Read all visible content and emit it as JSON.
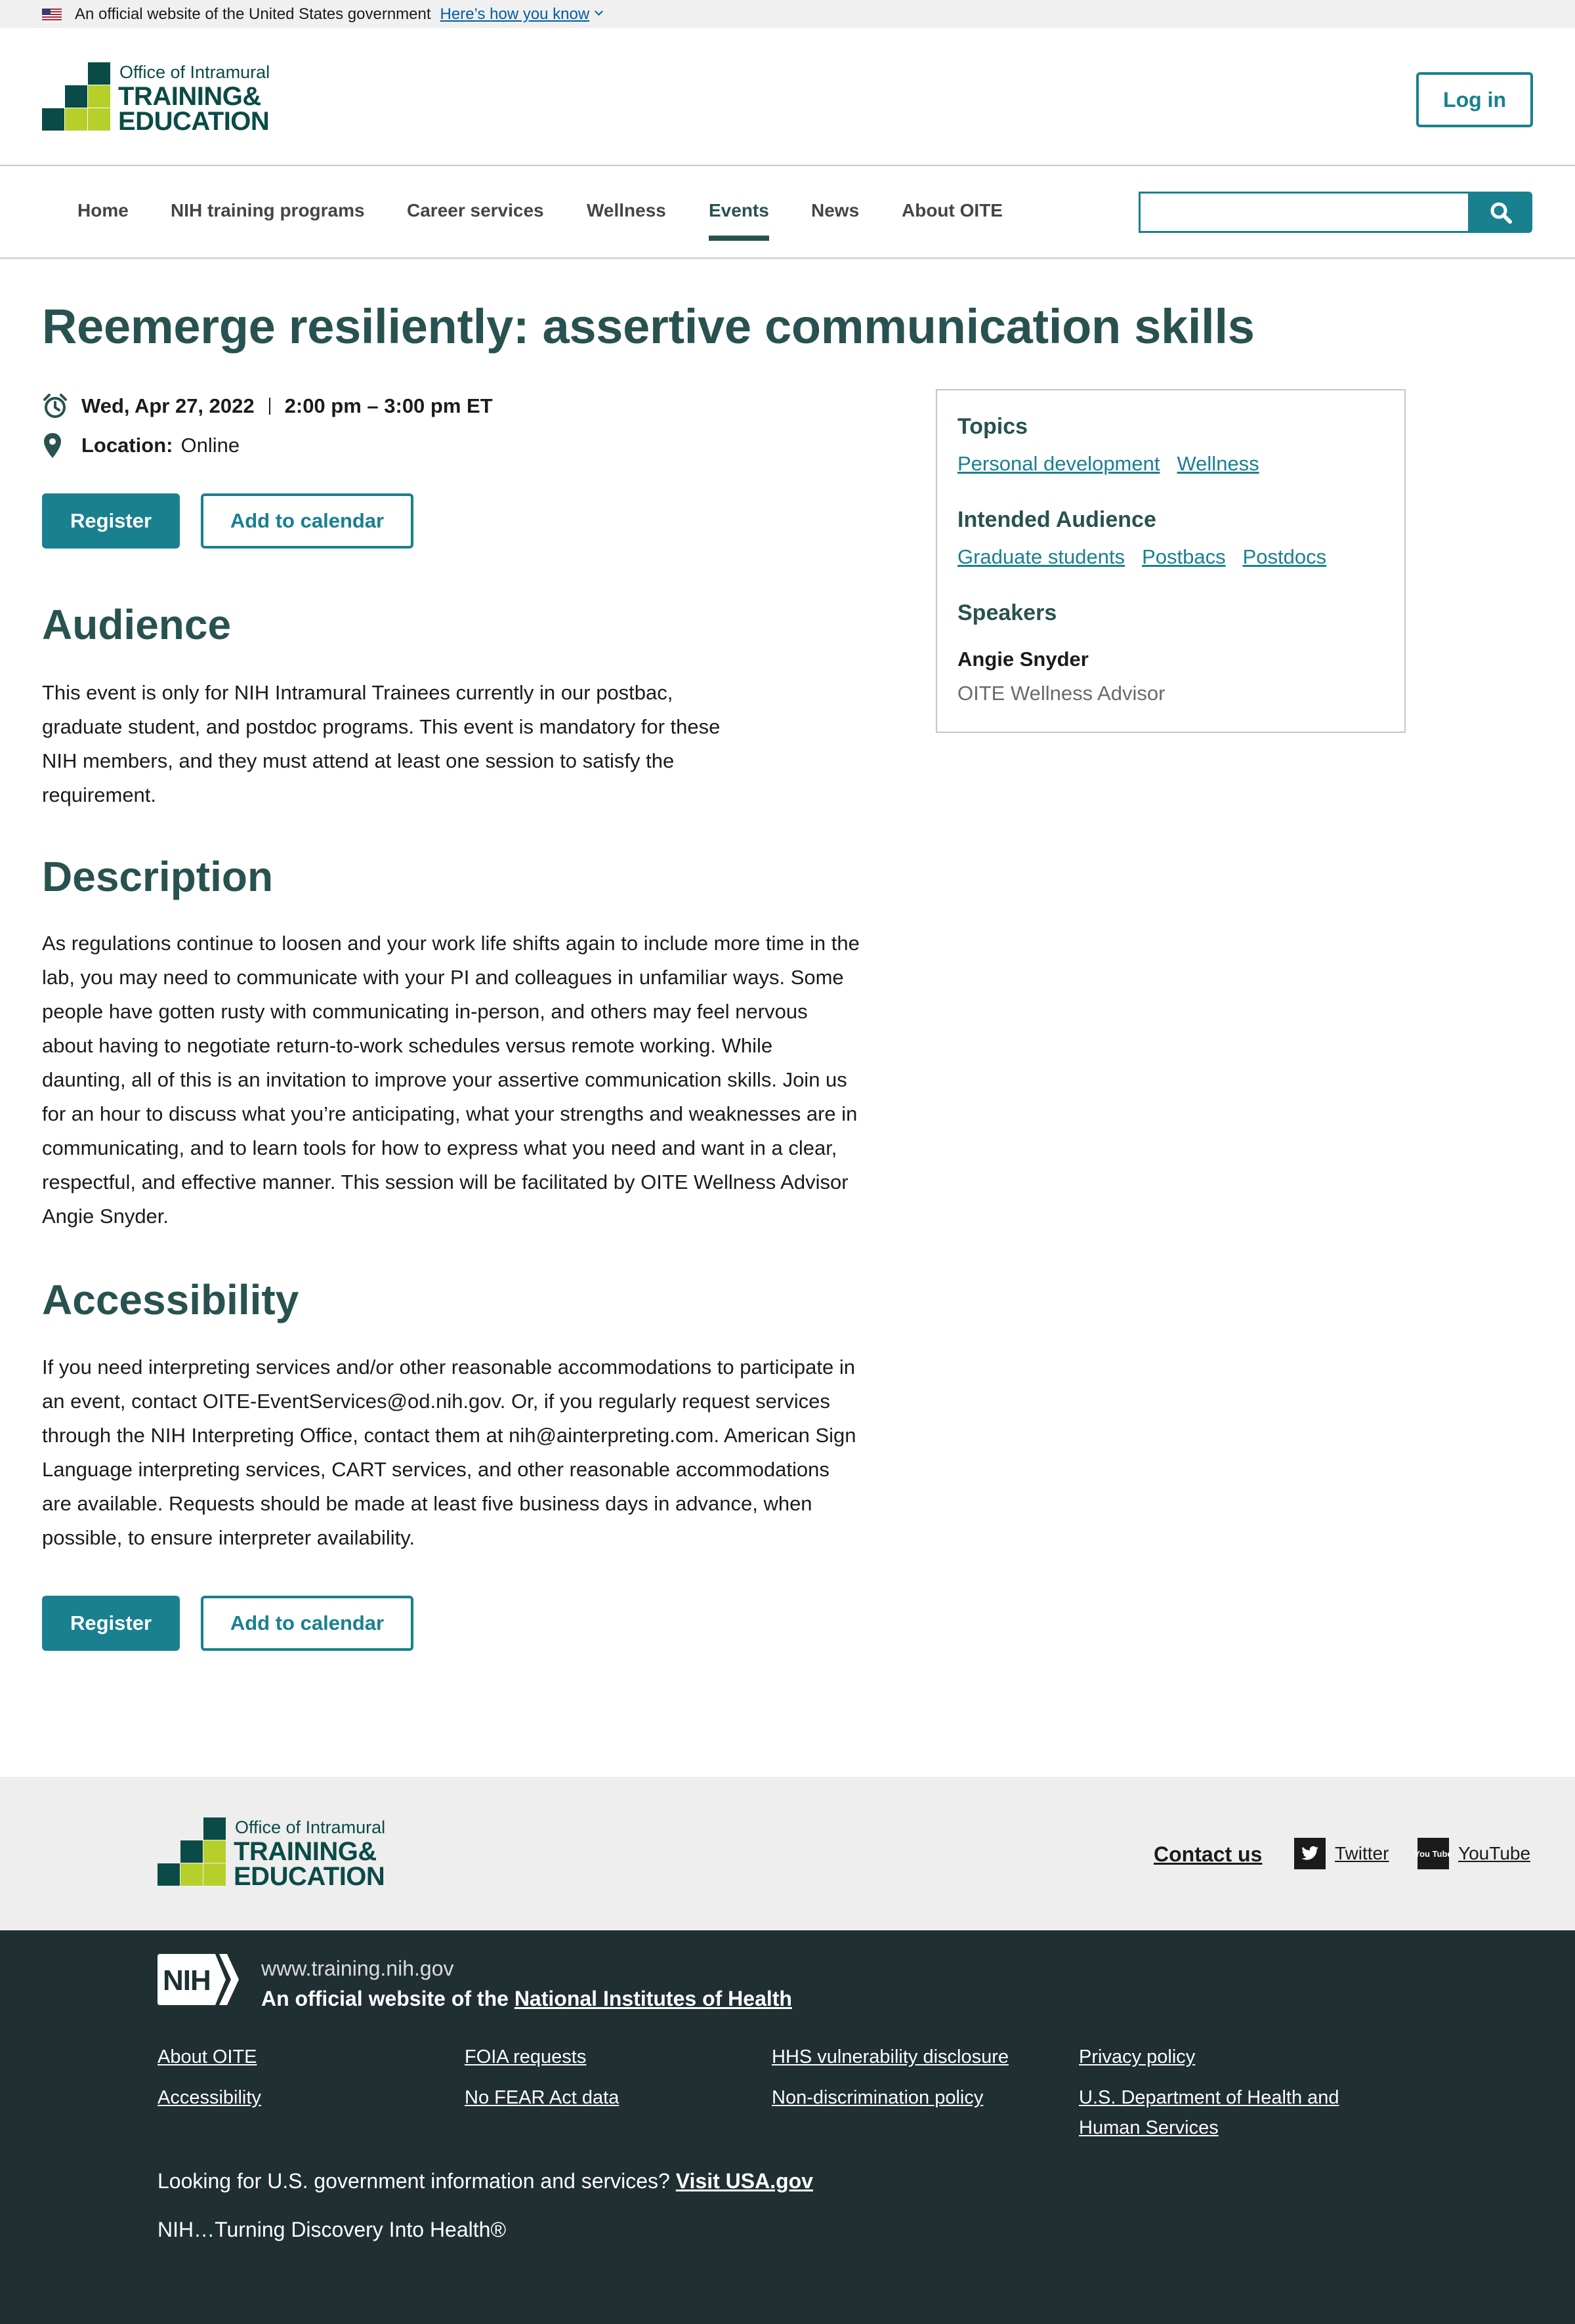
{
  "gov_banner": {
    "text": "An official website of the United States government",
    "link": "Here’s how you know"
  },
  "header": {
    "logo": {
      "line1": "Office of Intramural",
      "line2": "TRAINING&",
      "line3": "EDUCATION"
    },
    "login_label": "Log in"
  },
  "nav": {
    "items": [
      {
        "label": "Home"
      },
      {
        "label": "NIH training programs"
      },
      {
        "label": "Career services"
      },
      {
        "label": "Wellness"
      },
      {
        "label": "Events",
        "active": true
      },
      {
        "label": "News"
      },
      {
        "label": "About OITE"
      }
    ],
    "search_placeholder": ""
  },
  "event": {
    "title": "Reemerge resiliently: assertive communication skills",
    "date": "Wed, Apr 27, 2022",
    "time": "2:00 pm – 3:00 pm ET",
    "location_label": "Location:",
    "location": "Online",
    "register_label": "Register",
    "calendar_label": "Add to calendar"
  },
  "sections": {
    "audience": {
      "heading": "Audience",
      "lines": [
        "This event is only for NIH Intramural Trainees currently in our postbac,",
        "graduate student, and postdoc programs.  This event is mandatory for these",
        "NIH members, and they must attend at least one session to satisfy the",
        "requirement."
      ]
    },
    "description": {
      "heading": "Description",
      "lines": [
        "As regulations continue to loosen and your work life shifts again to include more time in the",
        "lab, you may need to communicate with your PI and colleagues in unfamiliar ways.  Some",
        "people have gotten rusty with communicating in-person, and others may feel nervous",
        "about having to negotiate return-to-work schedules versus remote working.   While",
        "daunting, all of this is an invitation to improve your assertive communication skills.  Join us",
        "for an hour to discuss what you’re anticipating, what your strengths and weaknesses are in",
        "communicating, and to learn tools for how to express what you need and want in a clear,",
        "respectful, and effective manner. This session will be facilitated by OITE Wellness Advisor",
        "Angie Snyder."
      ]
    },
    "accessibility": {
      "heading": "Accessibility",
      "lines": [
        "If you need interpreting services and/or other reasonable accommodations to participate in",
        "an event, contact OITE-EventServices@od.nih.gov. Or, if you regularly request services",
        "through the NIH Interpreting Office, contact them at nih@ainterpreting.com. American Sign",
        "Language interpreting services, CART services, and other reasonable accommodations",
        "are available. Requests should be made at least five business days in advance, when",
        "possible, to ensure interpreter availability."
      ]
    }
  },
  "sidebar": {
    "topics_heading": "Topics",
    "topics": [
      "Personal development",
      "Wellness"
    ],
    "audience_heading": "Intended Audience",
    "audience": [
      "Graduate students",
      "Postbacs",
      "Postdocs"
    ],
    "speakers_heading": "Speakers",
    "speaker_name": "Angie Snyder",
    "speaker_role": "OITE Wellness Advisor"
  },
  "footer_top": {
    "logo": {
      "line1": "Office of Intramural",
      "line2": "TRAINING&",
      "line3": "EDUCATION"
    },
    "contact": "Contact us",
    "twitter": "Twitter",
    "youtube": "YouTube",
    "youtube_icon_text": "You Tube"
  },
  "footer": {
    "nih_badge": "NIH",
    "url": "www.training.nih.gov",
    "official_prefix": "An official website of the ",
    "official_link": "National Institutes of Health",
    "links": {
      "col1": [
        "About OITE",
        "Accessibility"
      ],
      "col2": [
        "FOIA requests",
        "No FEAR Act data"
      ],
      "col3": [
        "HHS vulnerability disclosure",
        "Non-discrimination policy"
      ],
      "col4": [
        "Privacy policy",
        "U.S. Department of Health and",
        "Human Services"
      ]
    },
    "usa_prefix": "Looking for U.S. government information and services? ",
    "usa_link": "Visit USA.gov",
    "tagline": "NIH…Turning Discovery Into Health®"
  }
}
